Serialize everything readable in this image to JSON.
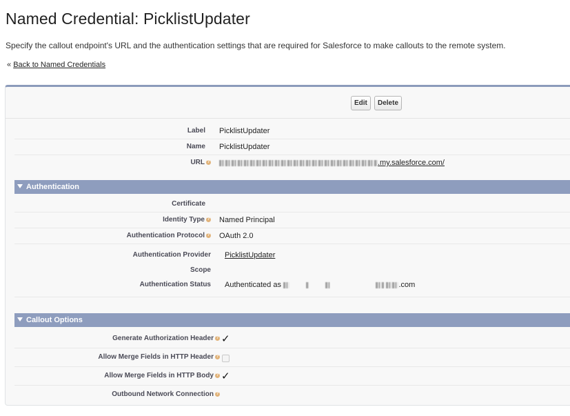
{
  "page": {
    "title": "Named Credential: PicklistUpdater",
    "description": "Specify the callout endpoint's URL and the authentication settings that are required for Salesforce to make callouts to the remote system.",
    "back_prefix": "«",
    "back_link": "Back to Named Credentials"
  },
  "buttons": {
    "edit": "Edit",
    "delete": "Delete"
  },
  "details": {
    "label_label": "Label",
    "label_value": "PicklistUpdater",
    "name_label": "Name",
    "name_value": "PicklistUpdater",
    "url_label": "URL",
    "url_suffix": ".my.salesforce.com/"
  },
  "authentication": {
    "section_title": "Authentication",
    "certificate_label": "Certificate",
    "certificate_value": "",
    "identity_type_label": "Identity Type",
    "identity_type_value": "Named Principal",
    "protocol_label": "Authentication Protocol",
    "protocol_value": "OAuth 2.0",
    "provider_label": "Authentication Provider",
    "provider_value": "PicklistUpdater",
    "scope_label": "Scope",
    "scope_value": "",
    "status_label": "Authenticated Status",
    "status_label_text": "Authentication Status",
    "status_prefix": "Authenticated as",
    "status_suffix": ".com"
  },
  "callout": {
    "section_title": "Callout Options",
    "gen_auth_header_label": "Generate Authorization Header",
    "gen_auth_header_checked": true,
    "merge_header_label": "Allow Merge Fields in HTTP Header",
    "merge_header_checked": false,
    "merge_body_label": "Allow Merge Fields in HTTP Body",
    "merge_body_checked": true,
    "outbound_label": "Outbound Network Connection",
    "outbound_value": ""
  },
  "icons": {
    "help": "help-icon",
    "check": "✓",
    "collapse": "triangle-down-icon"
  }
}
